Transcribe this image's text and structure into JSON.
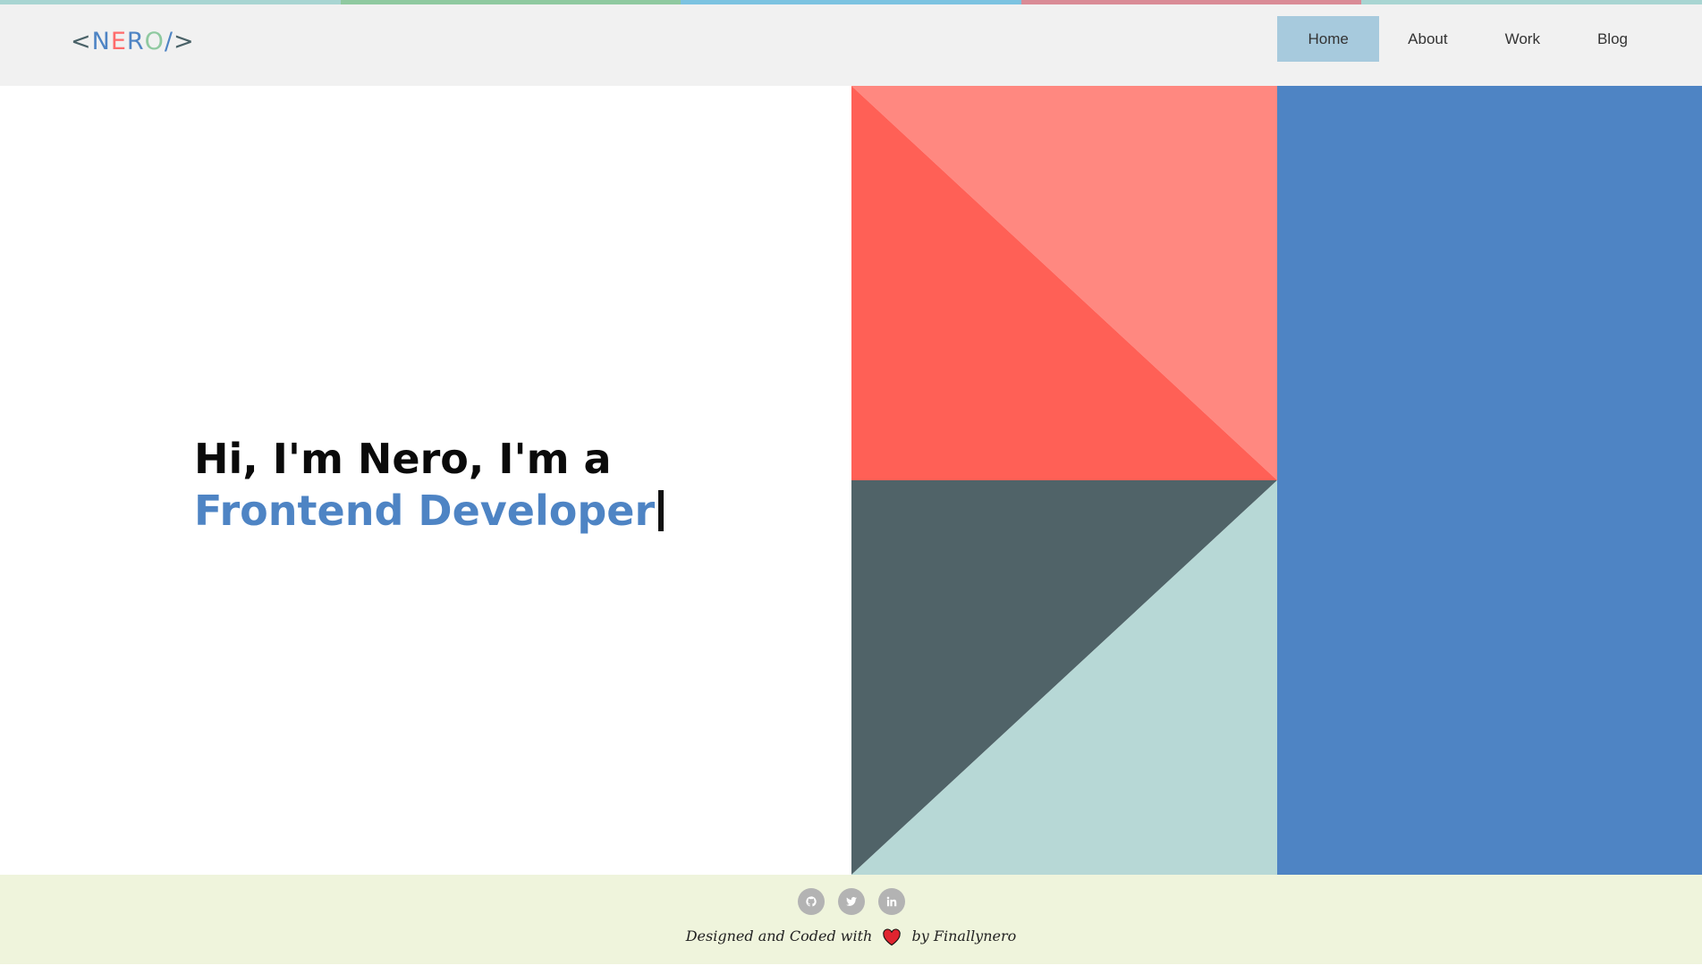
{
  "colors": {
    "stripe": [
      "#a8d5d2",
      "#8fc9a0",
      "#7cc3e1",
      "#d98b96",
      "#a8d5d2"
    ],
    "header_bg": "#f1f1f1",
    "nav_active_bg": "#a7cadd",
    "accent_blue": "#4e84c4",
    "coral_light": "#ff8880",
    "coral": "#ff6056",
    "slate": "#506368",
    "mint": "#b7d8d6",
    "footer_bg": "#eff4dc",
    "heart": "#e0242f"
  },
  "logo": {
    "chars": [
      "<",
      "N",
      "E",
      "R",
      "O",
      "/",
      ">"
    ],
    "colors": [
      "#4a6268",
      "#4e84c4",
      "#ff6b6b",
      "#4e84c4",
      "#8fc9a0",
      "#4e84c4",
      "#4a6268"
    ]
  },
  "nav": {
    "items": [
      "Home",
      "About",
      "Work",
      "Blog"
    ],
    "active": "Home"
  },
  "hero": {
    "line1": "Hi, I'm Nero, I'm a",
    "role": "Frontend Developer"
  },
  "footer": {
    "socials": [
      "github-icon",
      "twitter-icon",
      "linkedin-icon"
    ],
    "credit_prefix": "Designed and Coded with",
    "credit_suffix": "by Finallynero"
  }
}
